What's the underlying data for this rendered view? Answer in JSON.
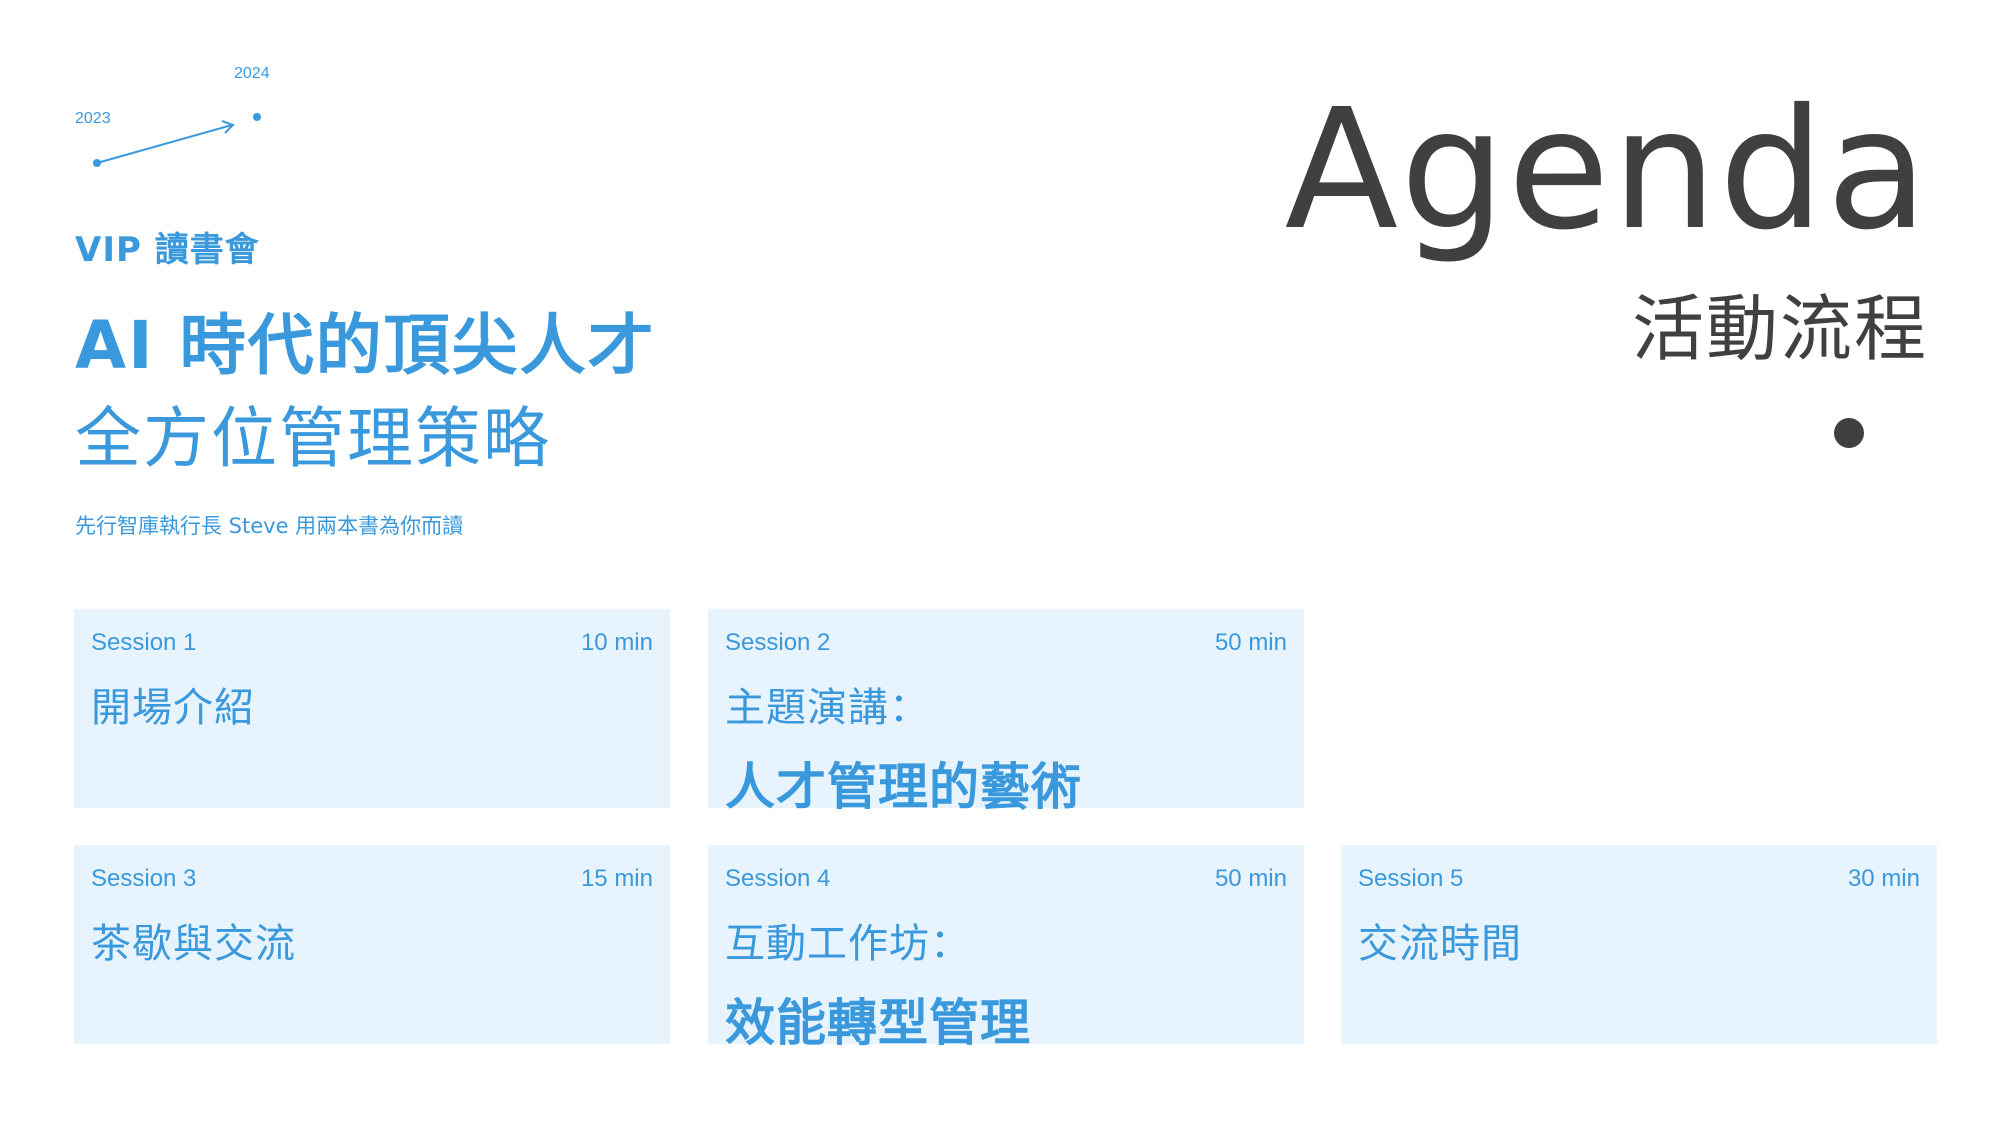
{
  "timeline": {
    "year_start": "2023",
    "year_end": "2024",
    "color": "#3a99dd"
  },
  "header": {
    "subtitle": "VIP 讀書會",
    "title_line1": "AI 時代的頂尖人才",
    "title_line2": "全方位管理策略",
    "byline": "先行智庫執行長 Steve 用兩本書為你而讀"
  },
  "agenda": {
    "title": "Agenda",
    "subtitle": "活動流程"
  },
  "sessions": [
    {
      "label": "Session 1",
      "duration": "10 min",
      "topic": "開場介紹",
      "topic_strong": ""
    },
    {
      "label": "Session 2",
      "duration": "50 min",
      "topic": "主題演講：",
      "topic_strong": "人才管理的藝術"
    },
    {
      "label": "Session 3",
      "duration": "15 min",
      "topic": "茶歇與交流",
      "topic_strong": ""
    },
    {
      "label": "Session 4",
      "duration": "50 min",
      "topic": "互動工作坊：",
      "topic_strong": "效能轉型管理"
    },
    {
      "label": "Session 5",
      "duration": "30 min",
      "topic": "交流時間",
      "topic_strong": ""
    }
  ],
  "colors": {
    "accent": "#3a99dd",
    "card_bg": "#e8f4fd",
    "dark": "#404040"
  }
}
